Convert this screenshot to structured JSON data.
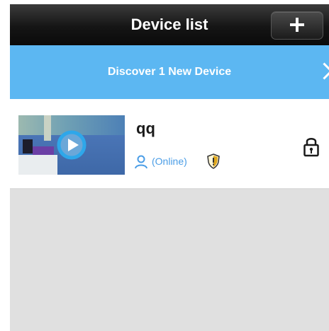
{
  "header": {
    "title": "Device list",
    "add_button_icon": "plus-icon"
  },
  "discover": {
    "label": "Discover 1 New Device",
    "icon": "chevron-right-icon"
  },
  "devices": [
    {
      "name": "qq",
      "status": "(Online)",
      "user_icon": "user-icon",
      "shield_icon": "shield-icon",
      "lock_icon": "lock-icon",
      "thumbnail_icon": "play-icon"
    }
  ],
  "colors": {
    "header_background": "#151515",
    "discover_background": "#5cb7f2",
    "accent": "#4a9de6",
    "play_ring": "#2ea7ea",
    "shield": "#e0a81e",
    "empty_background": "#e0e0e0"
  }
}
